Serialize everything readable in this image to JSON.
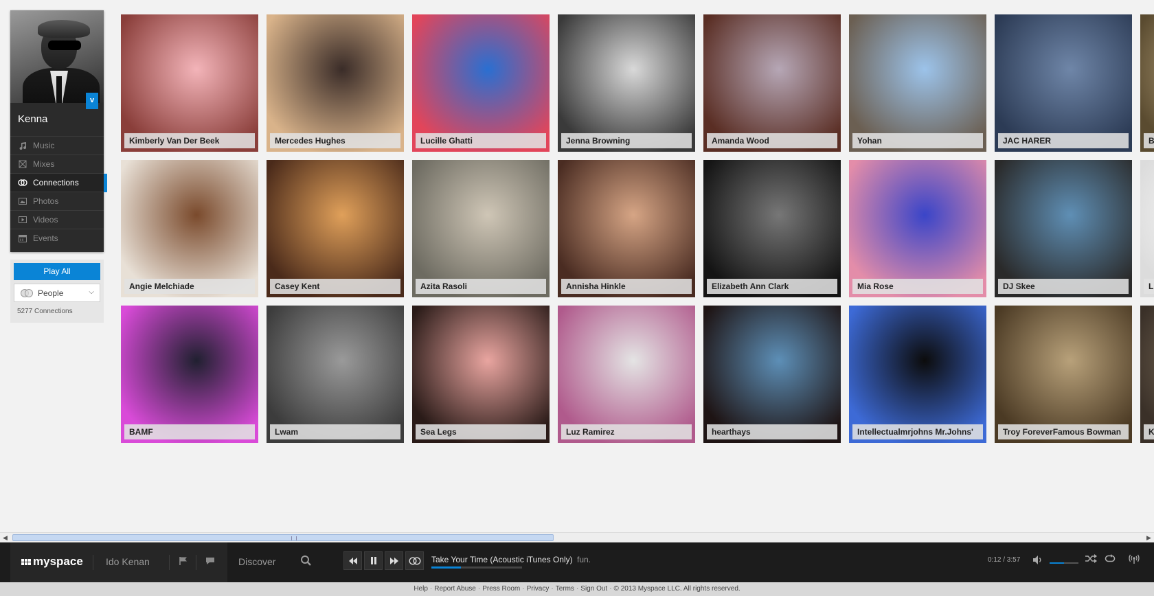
{
  "profile": {
    "name": "Kenna",
    "badge": "v",
    "nav": [
      {
        "label": "Music",
        "icon": "music-note-icon",
        "active": false
      },
      {
        "label": "Mixes",
        "icon": "mixes-icon",
        "active": false
      },
      {
        "label": "Connections",
        "icon": "connections-icon",
        "active": true
      },
      {
        "label": "Photos",
        "icon": "photo-icon",
        "active": false
      },
      {
        "label": "Videos",
        "icon": "video-icon",
        "active": false
      },
      {
        "label": "Events",
        "icon": "calendar-icon",
        "active": false
      }
    ]
  },
  "controls": {
    "play_all": "Play All",
    "filter": "People",
    "count": "5277 Connections"
  },
  "connections": [
    {
      "name": "Kimberly Van Der Beek",
      "c1": "#f3b4b9",
      "c2": "#8a3e3a"
    },
    {
      "name": "Mercedes Hughes",
      "c1": "#3a2c28",
      "c2": "#d9b38a"
    },
    {
      "name": "Lucille Ghatti",
      "c1": "#2a6fd1",
      "c2": "#e2455a"
    },
    {
      "name": "Jenna Browning",
      "c1": "#d9d9d9",
      "c2": "#3a3a3a"
    },
    {
      "name": "Amanda Wood",
      "c1": "#b6a7b6",
      "c2": "#5a2e24"
    },
    {
      "name": "Yohan",
      "c1": "#9cc3ea",
      "c2": "#6b5f52"
    },
    {
      "name": "JAC HARER",
      "c1": "#6f86a8",
      "c2": "#2c3b55"
    },
    {
      "name": "B",
      "c1": "#c9b48a",
      "c2": "#5a4b30"
    },
    {
      "name": "Angie Melchiade",
      "c1": "#7a4a2c",
      "c2": "#e8e0d6"
    },
    {
      "name": "Casey Kent",
      "c1": "#e0a05a",
      "c2": "#4a2a1a"
    },
    {
      "name": "Azita Rasoli",
      "c1": "#cfc6b6",
      "c2": "#6d6b61"
    },
    {
      "name": "Annisha Hinkle",
      "c1": "#d6a585",
      "c2": "#4a2c22"
    },
    {
      "name": "Elizabeth Ann Clark",
      "c1": "#777777",
      "c2": "#141414"
    },
    {
      "name": "Mia Rose",
      "c1": "#3a45c8",
      "c2": "#e38da9"
    },
    {
      "name": "DJ Skee",
      "c1": "#5f8fb5",
      "c2": "#2a2a2a"
    },
    {
      "name": "L",
      "c1": "#ffffff",
      "c2": "#dcdcdc"
    },
    {
      "name": "BAMF",
      "c1": "#202030",
      "c2": "#d94bd8"
    },
    {
      "name": "Lwam",
      "c1": "#9a9a9a",
      "c2": "#3c3c3c"
    },
    {
      "name": "Sea Legs",
      "c1": "#e9a5a0",
      "c2": "#2a1b18"
    },
    {
      "name": "Luz Ramirez",
      "c1": "#e4e4e4",
      "c2": "#b05a8c"
    },
    {
      "name": "hearthays",
      "c1": "#5d8fb7",
      "c2": "#1e1414"
    },
    {
      "name": "Intellectualmrjohns Mr.Johns'",
      "c1": "#0c0c0c",
      "c2": "#3d6ad6"
    },
    {
      "name": "Troy ForeverFamous Bowman",
      "c1": "#b8a17a",
      "c2": "#4b3a24"
    },
    {
      "name": "K",
      "c1": "#8a7a64",
      "c2": "#3a3028"
    }
  ],
  "player": {
    "brand": "myspace",
    "user": "Ido Kenan",
    "discover": "Discover",
    "track_title": "Take Your Time (Acoustic iTunes Only)",
    "track_artist": "fun.",
    "time": "0:12 / 3:57",
    "progress": 0.05,
    "volume": 0.5
  },
  "footer": {
    "links": [
      "Help",
      "Report Abuse",
      "Press Room",
      "Privacy",
      "Terms",
      "Sign Out"
    ],
    "copyright": "© 2013 Myspace LLC. All rights reserved."
  }
}
